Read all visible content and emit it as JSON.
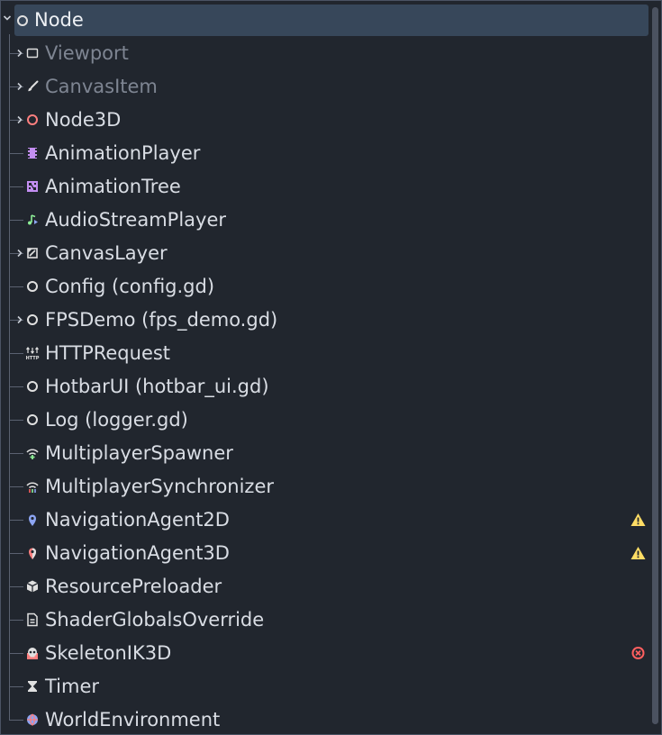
{
  "tree": {
    "root": {
      "label": "Node",
      "icon": "node-circle-icon"
    },
    "items": [
      {
        "label": "Viewport",
        "icon": "viewport-icon",
        "dim": true,
        "expandable": true
      },
      {
        "label": "CanvasItem",
        "icon": "brush-icon",
        "dim": true,
        "expandable": true
      },
      {
        "label": "Node3D",
        "icon": "node3d-circle-icon",
        "dim": false,
        "expandable": true
      },
      {
        "label": "AnimationPlayer",
        "icon": "film-icon",
        "dim": false,
        "expandable": false
      },
      {
        "label": "AnimationTree",
        "icon": "animation-tree-icon",
        "dim": false,
        "expandable": false
      },
      {
        "label": "AudioStreamPlayer",
        "icon": "music-note-icon",
        "dim": false,
        "expandable": false
      },
      {
        "label": "CanvasLayer",
        "icon": "canvas-layer-icon",
        "dim": false,
        "expandable": true
      },
      {
        "label": "Config (config.gd)",
        "icon": "node-circle-icon",
        "dim": false,
        "expandable": false
      },
      {
        "label": "FPSDemo (fps_demo.gd)",
        "icon": "node-circle-icon",
        "dim": false,
        "expandable": true
      },
      {
        "label": "HTTPRequest",
        "icon": "http-icon",
        "dim": false,
        "expandable": false
      },
      {
        "label": "HotbarUI (hotbar_ui.gd)",
        "icon": "node-circle-icon",
        "dim": false,
        "expandable": false
      },
      {
        "label": "Log (logger.gd)",
        "icon": "node-circle-icon",
        "dim": false,
        "expandable": false
      },
      {
        "label": "MultiplayerSpawner",
        "icon": "wifi-plus-icon",
        "dim": false,
        "expandable": false
      },
      {
        "label": "MultiplayerSynchronizer",
        "icon": "wifi-sync-icon",
        "dim": false,
        "expandable": false
      },
      {
        "label": "NavigationAgent2D",
        "icon": "map-pin-2d-icon",
        "dim": false,
        "expandable": false,
        "status": "warning"
      },
      {
        "label": "NavigationAgent3D",
        "icon": "map-pin-3d-icon",
        "dim": false,
        "expandable": false,
        "status": "warning"
      },
      {
        "label": "ResourcePreloader",
        "icon": "cube-icon",
        "dim": false,
        "expandable": false
      },
      {
        "label": "ShaderGlobalsOverride",
        "icon": "shader-doc-icon",
        "dim": false,
        "expandable": false
      },
      {
        "label": "SkeletonIK3D",
        "icon": "skull-icon",
        "dim": false,
        "expandable": false,
        "status": "error"
      },
      {
        "label": "Timer",
        "icon": "hourglass-icon",
        "dim": false,
        "expandable": false
      },
      {
        "label": "WorldEnvironment",
        "icon": "globe-icon",
        "dim": false,
        "expandable": false
      }
    ]
  },
  "colors": {
    "background": "#21262e",
    "selection": "#37475a",
    "text": "#d9dde4",
    "text_dim": "#7e8592",
    "warning": "#ffdd65",
    "error": "#ff5f5f"
  }
}
